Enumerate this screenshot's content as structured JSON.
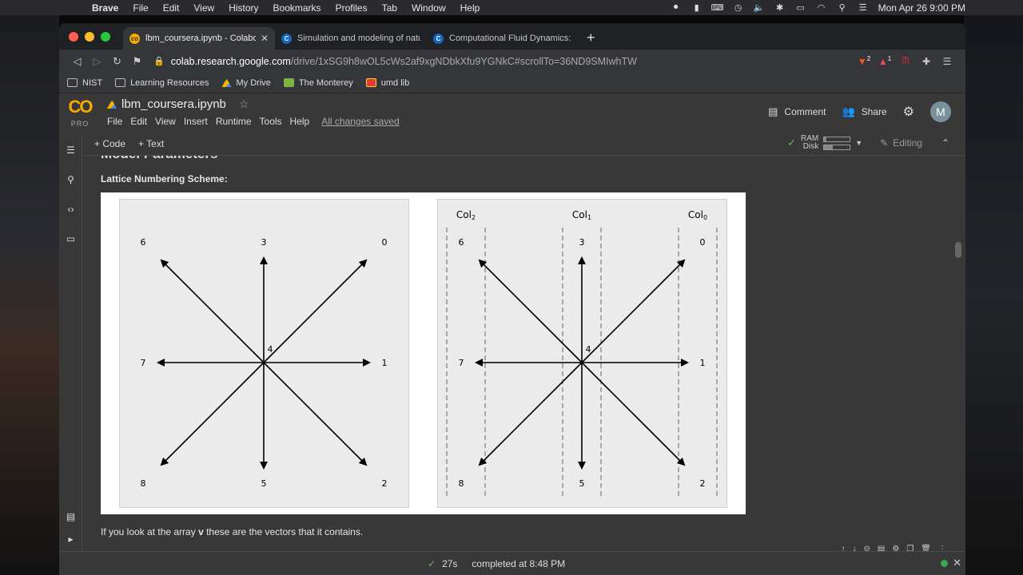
{
  "menubar": {
    "app": "Brave",
    "items": [
      "File",
      "Edit",
      "View",
      "History",
      "Bookmarks",
      "Profiles",
      "Tab",
      "Window",
      "Help"
    ],
    "clock": "Mon Apr 26  9:00 PM"
  },
  "browser": {
    "tabs": [
      {
        "title": "lbm_coursera.ipynb - Colaboratory",
        "active": true
      },
      {
        "title": "Simulation and modeling of natural processes",
        "active": false
      },
      {
        "title": "Computational Fluid Dynamics: Overview",
        "active": false
      }
    ],
    "url_host": "colab.research.google.com",
    "url_path": "/drive/1xSG9h8wOL5cWs2af9xgNDbkXfu9YGNkC#scrollTo=36ND9SMIwhTW",
    "ext_badges": {
      "brave": "2",
      "alert": "1"
    },
    "bookmarks": [
      "NIST",
      "Learning Resources",
      "My Drive",
      "The Monterey",
      "umd lib"
    ]
  },
  "colab": {
    "logo": "CO",
    "logo_sub": "PRO",
    "notebook_title": "lbm_coursera.ipynb",
    "menu": [
      "File",
      "Edit",
      "View",
      "Insert",
      "Runtime",
      "Tools",
      "Help"
    ],
    "save_status": "All changes saved",
    "comment_label": "Comment",
    "share_label": "Share",
    "avatar_initial": "M",
    "add_code": "+ Code",
    "add_text": "+ Text",
    "ram_label": "RAM",
    "disk_label": "Disk",
    "ram_usage": 0.1,
    "disk_usage": 0.35,
    "editing_label": "Editing"
  },
  "cell": {
    "clipped_heading": "Model Parameters",
    "subheading": "Lattice Numbering Scheme:",
    "caption_before": "If you look at the array ",
    "caption_var": "v",
    "caption_after": " these are the vectors that it contains."
  },
  "lattice": {
    "direction_labels": [
      "0",
      "1",
      "2",
      "3",
      "4",
      "5",
      "6",
      "7",
      "8"
    ],
    "column_labels": [
      {
        "base": "Col",
        "sub": "2"
      },
      {
        "base": "Col",
        "sub": "1"
      },
      {
        "base": "Col",
        "sub": "0"
      }
    ]
  },
  "status": {
    "duration": "27s",
    "completed": "completed at 8:48 PM"
  }
}
